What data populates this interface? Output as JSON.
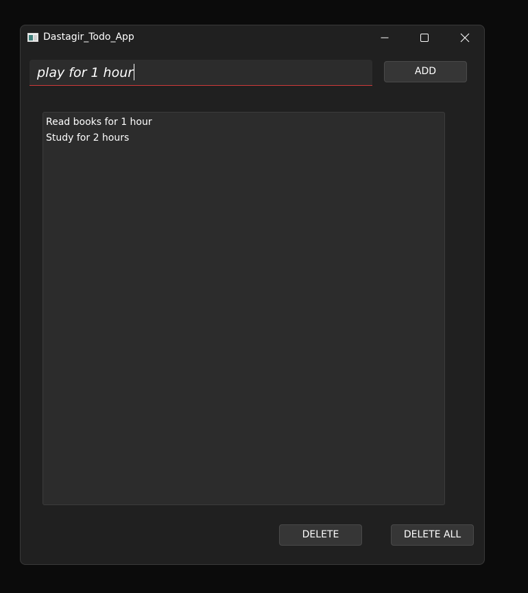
{
  "window": {
    "title": "Dastagir_Todo_App",
    "controls": [
      "minimize-icon",
      "maximize-icon",
      "close-icon"
    ]
  },
  "input": {
    "value": "play for 1 hour",
    "accent_color": "#d03a3a"
  },
  "buttons": {
    "add_label": "ADD",
    "delete_label": "DELETE",
    "delete_all_label": "DELETE ALL"
  },
  "todo_list": {
    "items": [
      {
        "label": "Read books for 1 hour"
      },
      {
        "label": "Study for 2 hours"
      }
    ]
  },
  "colors": {
    "background": "#0b0b0b",
    "window_bg": "#202020",
    "panel_bg": "#2c2c2c",
    "text": "#ffffff"
  }
}
